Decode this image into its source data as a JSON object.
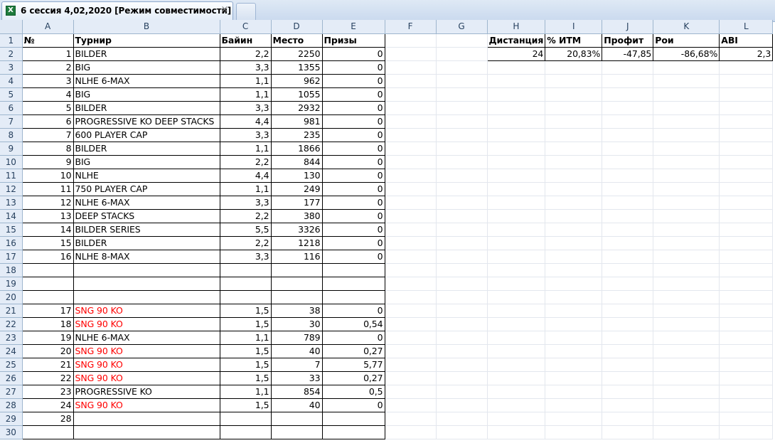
{
  "tab": {
    "title": "6 сессия 4,02,2020  [Режим совместимости]",
    "close": "×"
  },
  "columns": [
    "A",
    "B",
    "C",
    "D",
    "E",
    "F",
    "G",
    "H",
    "I",
    "J",
    "K",
    "L"
  ],
  "header_row": [
    "№",
    "Турнир",
    "Байин",
    "Место",
    "Призы",
    "",
    "",
    "Дистанция",
    "% ИТМ",
    "Профит",
    "Рои",
    "ABI"
  ],
  "stats_row": [
    "1",
    "BILDER",
    "2,2",
    "2250",
    "0",
    "",
    "",
    "24",
    "20,83%",
    "-47,85",
    "-86,68%",
    "2,3"
  ],
  "rows": [
    [
      "2",
      "BIG",
      "3,3",
      "1355",
      "0"
    ],
    [
      "3",
      "NLHE 6-MAX",
      "1,1",
      "962",
      "0"
    ],
    [
      "4",
      "BIG",
      "1,1",
      "1055",
      "0"
    ],
    [
      "5",
      "BILDER",
      "3,3",
      "2932",
      "0"
    ],
    [
      "6",
      "PROGRESSIVE KO DEEP STACKS",
      "4,4",
      "981",
      "0"
    ],
    [
      "7",
      "600 PLAYER CAP",
      "3,3",
      "235",
      "0"
    ],
    [
      "8",
      "BILDER",
      "1,1",
      "1866",
      "0"
    ],
    [
      "9",
      "BIG",
      "2,2",
      "844",
      "0"
    ],
    [
      "10",
      "NLHE",
      "4,4",
      "130",
      "0"
    ],
    [
      "11",
      "750 PLAYER CAP",
      "1,1",
      "249",
      "0"
    ],
    [
      "12",
      "NLHE 6-MAX",
      "3,3",
      "177",
      "0"
    ],
    [
      "13",
      "DEEP STACKS",
      "2,2",
      "380",
      "0"
    ],
    [
      "14",
      "BILDER SERIES",
      "5,5",
      "3326",
      "0"
    ],
    [
      "15",
      "BILDER",
      "2,2",
      "1218",
      "0"
    ],
    [
      "16",
      "NLHE 8-MAX",
      "3,3",
      "116",
      "0"
    ],
    [
      "",
      "",
      "",
      "",
      ""
    ],
    [
      "",
      "",
      "",
      "",
      ""
    ],
    [
      "",
      "",
      "",
      "",
      ""
    ],
    [
      "17",
      "SNG 90 KO",
      "1,5",
      "38",
      "0"
    ],
    [
      "18",
      "SNG 90 KO",
      "1,5",
      "30",
      "0,54"
    ],
    [
      "19",
      "NLHE 6-MAX",
      "1,1",
      "789",
      "0"
    ],
    [
      "20",
      "SNG 90 KO",
      "1,5",
      "40",
      "0,27"
    ],
    [
      "21",
      "SNG 90 KO",
      "1,5",
      "7",
      "5,77"
    ],
    [
      "22",
      "SNG 90 KO",
      "1,5",
      "33",
      "0,27"
    ],
    [
      "23",
      "PROGRESSIVE KO",
      "1,1",
      "854",
      "0,5"
    ],
    [
      "24",
      "SNG 90 KO",
      "1,5",
      "40",
      "0"
    ],
    [
      "28",
      "",
      "",
      "",
      ""
    ]
  ],
  "red_text_color": "#ff0000"
}
